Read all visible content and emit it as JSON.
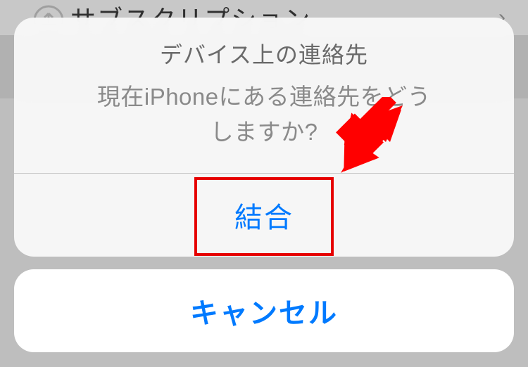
{
  "background": {
    "row_text": "サブスクリプション"
  },
  "actionSheet": {
    "title": "デバイス上の連絡先",
    "message_line1": "現在iPhoneにある連絡先をどう",
    "message_line2": "しますか?",
    "primaryAction": "結合",
    "cancel": "キャンセル"
  },
  "annotations": {
    "arrow_color": "#ff0000",
    "highlight_color": "#e60000"
  }
}
